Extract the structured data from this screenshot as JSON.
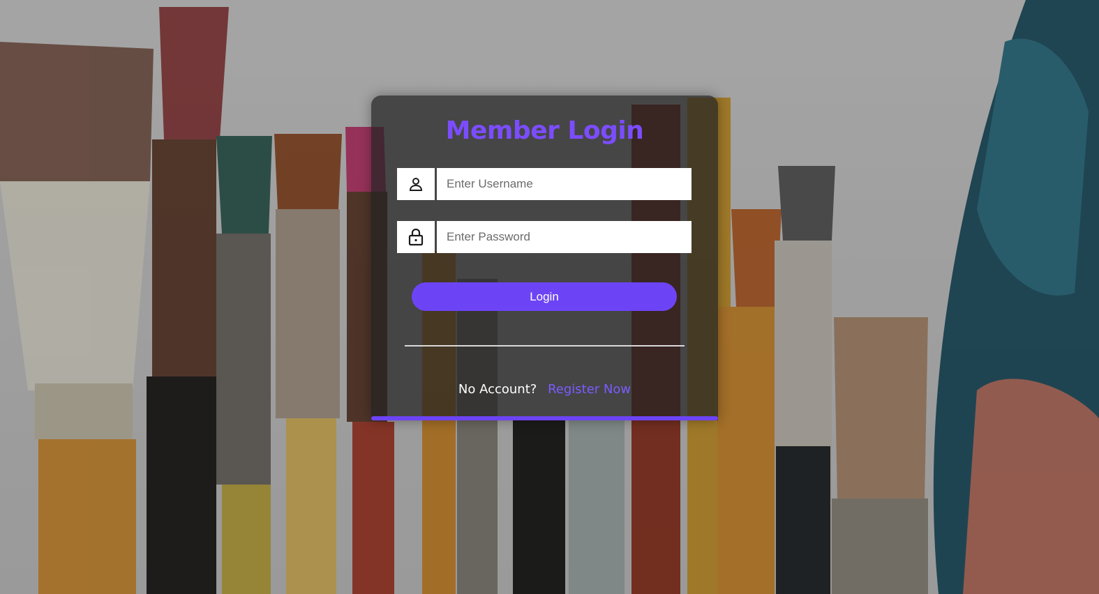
{
  "login": {
    "title": "Member Login",
    "username_placeholder": "Enter Username",
    "password_placeholder": "Enter Password",
    "button_label": "Login",
    "no_account_text": "No Account?",
    "register_link": "Register Now"
  },
  "icons": {
    "username": "user-icon",
    "password": "lock-icon"
  },
  "colors": {
    "accent": "#6d44f5",
    "title": "#7b4dff",
    "link": "#7b5cff"
  }
}
